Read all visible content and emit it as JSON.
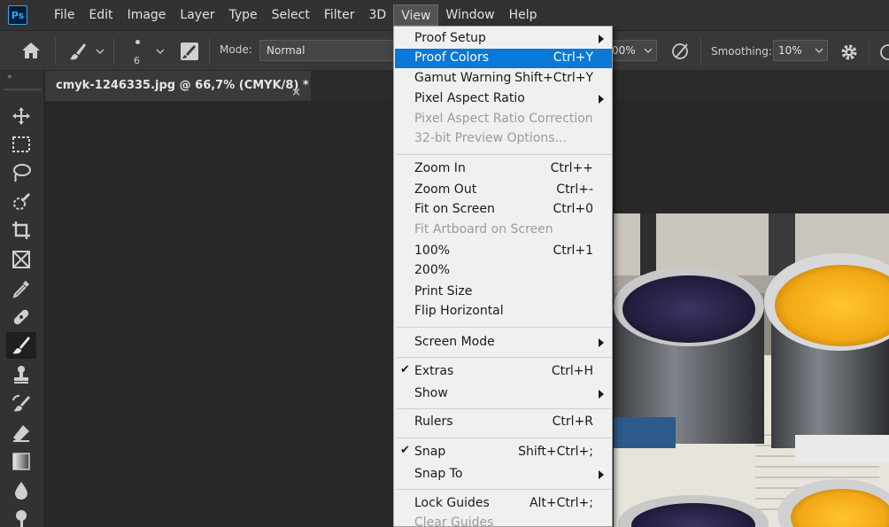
{
  "app": {
    "logo_text": "Ps",
    "menu": [
      "File",
      "Edit",
      "Image",
      "Layer",
      "Type",
      "Select",
      "Filter",
      "3D",
      "View",
      "Window",
      "Help"
    ],
    "active_menu": "View"
  },
  "options": {
    "brush_size": "6",
    "mode_label": "Mode:",
    "mode_value": "Normal",
    "opacity_value": "00%",
    "smoothing_label": "Smoothing:",
    "smoothing_value": "10%"
  },
  "document": {
    "tab_title": "cmyk-1246335.jpg @ 66,7% (CMYK/8) *",
    "close_glyph": "×"
  },
  "view_menu": {
    "items": [
      {
        "label": "Proof Setup",
        "shortcut": "",
        "submenu": true,
        "disabled": false,
        "checked": false,
        "highlighted": false
      },
      {
        "label": "Proof Colors",
        "shortcut": "Ctrl+Y",
        "submenu": false,
        "disabled": false,
        "checked": false,
        "highlighted": true
      },
      {
        "label": "Gamut Warning",
        "shortcut": "Shift+Ctrl+Y",
        "submenu": false,
        "disabled": false,
        "checked": false,
        "highlighted": false
      },
      {
        "label": "Pixel Aspect Ratio",
        "shortcut": "",
        "submenu": true,
        "disabled": false,
        "checked": false,
        "highlighted": false
      },
      {
        "label": "Pixel Aspect Ratio Correction",
        "shortcut": "",
        "submenu": false,
        "disabled": true,
        "checked": false,
        "highlighted": false
      },
      {
        "label": "32-bit Preview Options...",
        "shortcut": "",
        "submenu": false,
        "disabled": true,
        "checked": false,
        "highlighted": false
      },
      {
        "label": "Zoom In",
        "shortcut": "Ctrl++",
        "submenu": false,
        "disabled": false,
        "checked": false,
        "highlighted": false
      },
      {
        "label": "Zoom Out",
        "shortcut": "Ctrl+-",
        "submenu": false,
        "disabled": false,
        "checked": false,
        "highlighted": false
      },
      {
        "label": "Fit on Screen",
        "shortcut": "Ctrl+0",
        "submenu": false,
        "disabled": false,
        "checked": false,
        "highlighted": false
      },
      {
        "label": "Fit Artboard on Screen",
        "shortcut": "",
        "submenu": false,
        "disabled": true,
        "checked": false,
        "highlighted": false
      },
      {
        "label": "100%",
        "shortcut": "Ctrl+1",
        "submenu": false,
        "disabled": false,
        "checked": false,
        "highlighted": false
      },
      {
        "label": "200%",
        "shortcut": "",
        "submenu": false,
        "disabled": false,
        "checked": false,
        "highlighted": false
      },
      {
        "label": "Print Size",
        "shortcut": "",
        "submenu": false,
        "disabled": false,
        "checked": false,
        "highlighted": false
      },
      {
        "label": "Flip Horizontal",
        "shortcut": "",
        "submenu": false,
        "disabled": false,
        "checked": false,
        "highlighted": false
      },
      {
        "label": "Screen Mode",
        "shortcut": "",
        "submenu": true,
        "disabled": false,
        "checked": false,
        "highlighted": false
      },
      {
        "label": "Extras",
        "shortcut": "Ctrl+H",
        "submenu": false,
        "disabled": false,
        "checked": true,
        "highlighted": false
      },
      {
        "label": "Show",
        "shortcut": "",
        "submenu": true,
        "disabled": false,
        "checked": false,
        "highlighted": false
      },
      {
        "label": "Rulers",
        "shortcut": "Ctrl+R",
        "submenu": false,
        "disabled": false,
        "checked": false,
        "highlighted": false
      },
      {
        "label": "Snap",
        "shortcut": "Shift+Ctrl+;",
        "submenu": false,
        "disabled": false,
        "checked": true,
        "highlighted": false
      },
      {
        "label": "Snap To",
        "shortcut": "",
        "submenu": true,
        "disabled": false,
        "checked": false,
        "highlighted": false
      },
      {
        "label": "Lock Guides",
        "shortcut": "Alt+Ctrl+;",
        "submenu": false,
        "disabled": false,
        "checked": false,
        "highlighted": false
      },
      {
        "label": "Clear Guides",
        "shortcut": "",
        "submenu": false,
        "disabled": true,
        "checked": false,
        "highlighted": false
      }
    ],
    "check_glyph": "✔"
  },
  "colors": {
    "highlight": "#0a78d7",
    "ps_blue": "#31a8ff",
    "yellow_ink": "#f2b31c",
    "purple_ink": "#2b2348"
  },
  "icons": {
    "toolbar": [
      "move-icon",
      "marquee-icon",
      "lasso-icon",
      "quick-select-icon",
      "crop-icon",
      "frame-icon",
      "eyedropper-icon",
      "healing-icon",
      "brush-icon",
      "stamp-icon",
      "history-brush-icon",
      "eraser-icon",
      "gradient-icon",
      "blur-icon",
      "dodge-icon"
    ]
  }
}
